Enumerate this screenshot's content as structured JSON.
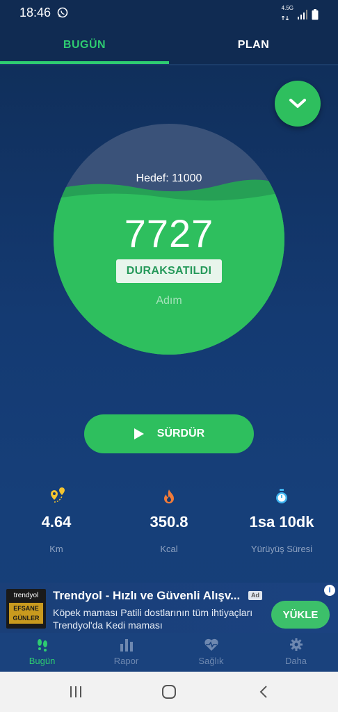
{
  "status": {
    "time": "18:46",
    "network": "4.5G"
  },
  "tabs": [
    {
      "label": "BUGÜN",
      "active": true
    },
    {
      "label": "PLAN",
      "active": false
    }
  ],
  "goal": {
    "label": "Hedef: 11000",
    "steps": "7727",
    "state": "DURAKSATILDI",
    "unit": "Adım",
    "progress": 0.7025
  },
  "resume_button": {
    "label": "SÜRDÜR"
  },
  "stats": [
    {
      "icon": "map-pin-icon",
      "value": "4.64",
      "label": "Km"
    },
    {
      "icon": "flame-icon",
      "value": "350.8",
      "label": "Kcal"
    },
    {
      "icon": "stopwatch-icon",
      "value": "1sa 10dk",
      "label": "Yürüyüş Süresi"
    }
  ],
  "ad": {
    "brand": "trendyol",
    "promo": "EFSANE GÜNLER",
    "title": "Trendyol - Hızlı ve Güvenli Alışv...",
    "tag": "Ad",
    "description": "Köpek maması Patili dostlarının tüm ihtiyaçları Trendyol'da Kedi maması",
    "cta": "YÜKLE",
    "info": "i"
  },
  "bottom_nav": [
    {
      "label": "Bugün",
      "icon": "footsteps-icon",
      "active": true
    },
    {
      "label": "Rapor",
      "icon": "bar-chart-icon",
      "active": false
    },
    {
      "label": "Sağlık",
      "icon": "heart-pulse-icon",
      "active": false
    },
    {
      "label": "Daha",
      "icon": "gear-icon",
      "active": false
    }
  ],
  "colors": {
    "accent": "#2ecc71",
    "button": "#2ebf5e",
    "background": "#143a72"
  }
}
